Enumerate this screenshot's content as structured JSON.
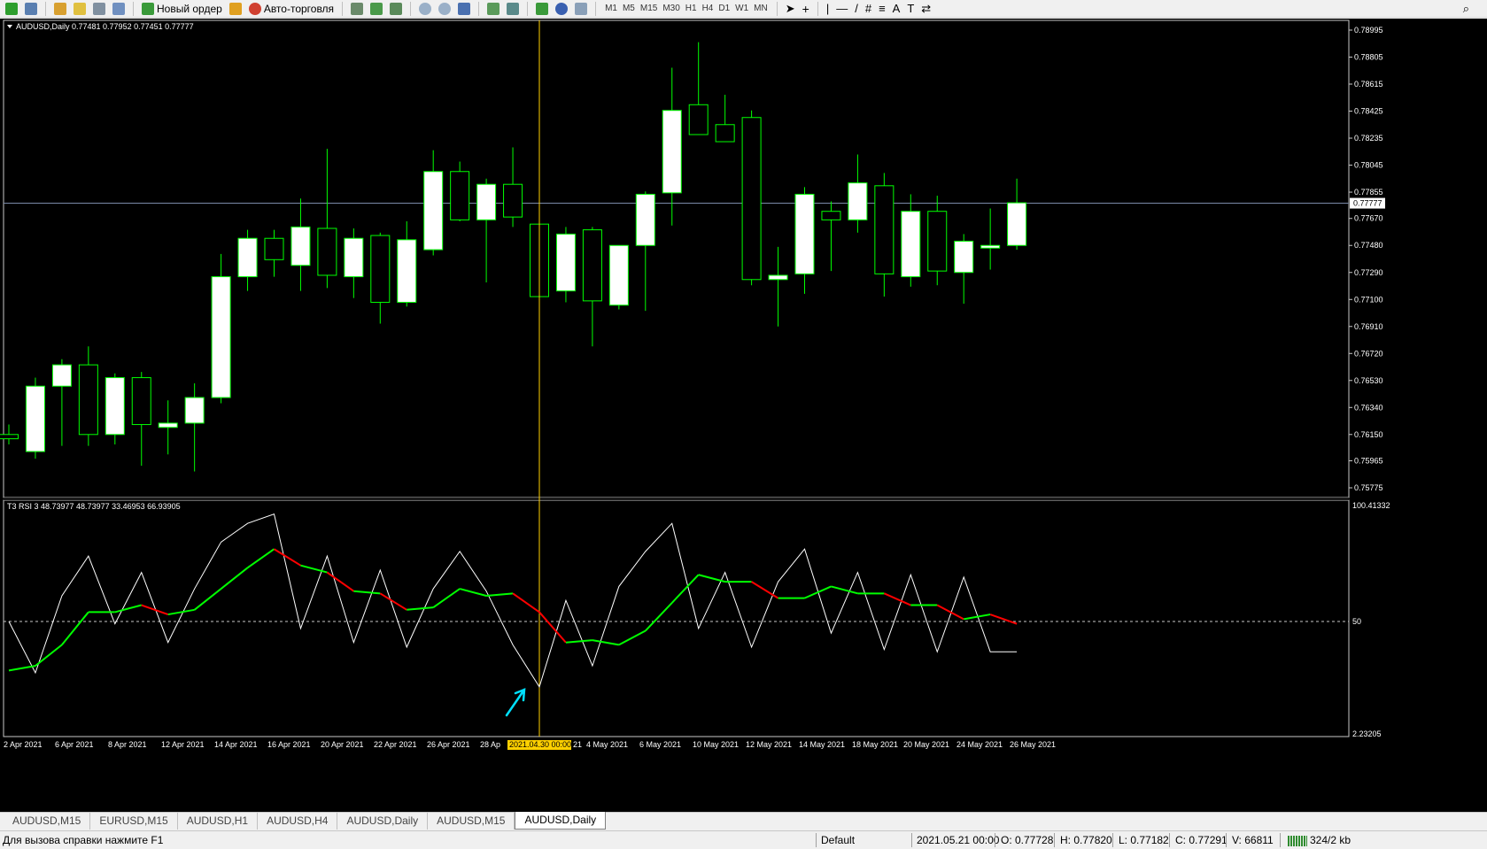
{
  "toolbar": {
    "new_order_label": "Новый ордер",
    "autotrading_label": "Авто-торговля",
    "timeframes": [
      "M1",
      "M5",
      "M15",
      "M30",
      "H1",
      "H4",
      "D1",
      "W1",
      "MN"
    ]
  },
  "main_chart": {
    "header": "AUDUSD,Daily  0.77481 0.77952 0.77451 0.77777",
    "current_price_label": "0.77777",
    "price_labels": [
      "0.78995",
      "0.78805",
      "0.78615",
      "0.78425",
      "0.78235",
      "0.78045",
      "0.77855",
      "0.77670",
      "0.77480",
      "0.77290",
      "0.77100",
      "0.76910",
      "0.76720",
      "0.76530",
      "0.76340",
      "0.76150",
      "0.75965",
      "0.75775"
    ]
  },
  "indicator": {
    "header": "T3 RSI 3 48.73977 48.73977 33.46953 66.93905",
    "top_label": "100.41332",
    "mid_label": "50",
    "bottom_label": "2.23205"
  },
  "x_axis": {
    "labels": [
      "2 Apr 2021",
      "6 Apr 2021",
      "8 Apr 2021",
      "12 Apr 2021",
      "14 Apr 2021",
      "16 Apr 2021",
      "20 Apr 2021",
      "22 Apr 2021",
      "26 Apr 2021",
      "28 Ap",
      "21",
      "4 May 2021",
      "6 May 2021",
      "10 May 2021",
      "12 May 2021",
      "14 May 2021",
      "18 May 2021",
      "20 May 2021",
      "24 May 2021",
      "26 May 2021"
    ],
    "crosshair_label": "2021.04.30 00:00"
  },
  "chart_data": {
    "type": "candlestick",
    "symbol": "AUDUSD",
    "timeframe": "Daily",
    "ylim": [
      0.75775,
      0.78995
    ],
    "candles": [
      {
        "o": 0.7615,
        "h": 0.7622,
        "l": 0.7608,
        "c": 0.7612
      },
      {
        "o": 0.7603,
        "h": 0.7655,
        "l": 0.7598,
        "c": 0.7649
      },
      {
        "o": 0.7649,
        "h": 0.7668,
        "l": 0.7607,
        "c": 0.7664
      },
      {
        "o": 0.7664,
        "h": 0.7677,
        "l": 0.7607,
        "c": 0.7615
      },
      {
        "o": 0.7615,
        "h": 0.7658,
        "l": 0.7608,
        "c": 0.7655
      },
      {
        "o": 0.7655,
        "h": 0.7659,
        "l": 0.7593,
        "c": 0.7622
      },
      {
        "o": 0.762,
        "h": 0.7639,
        "l": 0.7601,
        "c": 0.7623
      },
      {
        "o": 0.7623,
        "h": 0.7651,
        "l": 0.7589,
        "c": 0.7641
      },
      {
        "o": 0.7641,
        "h": 0.7742,
        "l": 0.7637,
        "c": 0.7726
      },
      {
        "o": 0.7726,
        "h": 0.7759,
        "l": 0.7716,
        "c": 0.7753
      },
      {
        "o": 0.7753,
        "h": 0.7759,
        "l": 0.7726,
        "c": 0.7738
      },
      {
        "o": 0.7734,
        "h": 0.7781,
        "l": 0.7716,
        "c": 0.7761
      },
      {
        "o": 0.776,
        "h": 0.7816,
        "l": 0.7718,
        "c": 0.7727
      },
      {
        "o": 0.7726,
        "h": 0.776,
        "l": 0.7711,
        "c": 0.7753
      },
      {
        "o": 0.7755,
        "h": 0.7757,
        "l": 0.7693,
        "c": 0.7708
      },
      {
        "o": 0.7708,
        "h": 0.7765,
        "l": 0.7705,
        "c": 0.7752
      },
      {
        "o": 0.7745,
        "h": 0.7815,
        "l": 0.7741,
        "c": 0.78
      },
      {
        "o": 0.78,
        "h": 0.7807,
        "l": 0.7765,
        "c": 0.7766
      },
      {
        "o": 0.7766,
        "h": 0.7795,
        "l": 0.7722,
        "c": 0.7791
      },
      {
        "o": 0.7791,
        "h": 0.7817,
        "l": 0.7761,
        "c": 0.7768
      },
      {
        "o": 0.7763,
        "h": 0.7784,
        "l": 0.7743,
        "c": 0.7712
      },
      {
        "o": 0.7716,
        "h": 0.7761,
        "l": 0.7708,
        "c": 0.7756
      },
      {
        "o": 0.7759,
        "h": 0.7761,
        "l": 0.7677,
        "c": 0.7709
      },
      {
        "o": 0.7706,
        "h": 0.7748,
        "l": 0.7703,
        "c": 0.7748
      },
      {
        "o": 0.7748,
        "h": 0.7786,
        "l": 0.7702,
        "c": 0.7784
      },
      {
        "o": 0.7785,
        "h": 0.7873,
        "l": 0.7762,
        "c": 0.7843
      },
      {
        "o": 0.7847,
        "h": 0.7891,
        "l": 0.7832,
        "c": 0.7826
      },
      {
        "o": 0.7833,
        "h": 0.7854,
        "l": 0.7821,
        "c": 0.7821
      },
      {
        "o": 0.7838,
        "h": 0.7843,
        "l": 0.772,
        "c": 0.7724
      },
      {
        "o": 0.7724,
        "h": 0.7747,
        "l": 0.7691,
        "c": 0.7727
      },
      {
        "o": 0.7728,
        "h": 0.7789,
        "l": 0.7714,
        "c": 0.7784
      },
      {
        "o": 0.7772,
        "h": 0.7779,
        "l": 0.773,
        "c": 0.7766
      },
      {
        "o": 0.7766,
        "h": 0.7812,
        "l": 0.7757,
        "c": 0.7792
      },
      {
        "o": 0.779,
        "h": 0.7799,
        "l": 0.7712,
        "c": 0.7728
      },
      {
        "o": 0.7726,
        "h": 0.7784,
        "l": 0.7719,
        "c": 0.7772
      },
      {
        "o": 0.7772,
        "h": 0.7783,
        "l": 0.772,
        "c": 0.773
      },
      {
        "o": 0.7729,
        "h": 0.7756,
        "l": 0.7707,
        "c": 0.7751
      },
      {
        "o": 0.7748,
        "h": 0.7774,
        "l": 0.7731,
        "c": 0.7748
      },
      {
        "o": 0.7748,
        "h": 0.7795,
        "l": 0.7745,
        "c": 0.7778
      }
    ],
    "rsi_fast": [
      50,
      28,
      61,
      78,
      49,
      71,
      41,
      64,
      84,
      92,
      96,
      47,
      78,
      41,
      72,
      39,
      64,
      80,
      63,
      40,
      22,
      59,
      31,
      65,
      80,
      92,
      47,
      71,
      39,
      67,
      81,
      45,
      71,
      38,
      70,
      37,
      69,
      37,
      37
    ],
    "rsi_smooth": [
      29,
      31,
      40,
      54,
      54,
      57,
      53,
      55,
      64,
      73,
      81,
      74,
      71,
      63,
      62,
      55,
      56,
      64,
      61,
      62,
      54,
      41,
      42,
      40,
      46,
      58,
      70,
      67,
      67,
      60,
      60,
      65,
      62,
      62,
      57,
      57,
      51,
      53,
      49
    ],
    "rsi_ylim": [
      2.23205,
      100.41332
    ],
    "level": 50,
    "current_price": 0.77777,
    "crosshair_index": 20
  },
  "colors": {
    "bull_body": "#ffffff",
    "candle_outline": "#00ff00",
    "rsi_fast": "#ffffff",
    "rsi_up": "#00ff00",
    "rsi_down": "#ff0000",
    "crosshair": "#ffd000",
    "arrow": "#00e0ff"
  },
  "tabs": [
    "AUDUSD,M15",
    "EURUSD,M15",
    "AUDUSD,H1",
    "AUDUSD,H4",
    "AUDUSD,Daily",
    "AUDUSD,M15",
    "AUDUSD,Daily"
  ],
  "status": {
    "help": "Для вызова справки нажмите F1",
    "profile": "Default",
    "datetime": "2021.05.21 00:00",
    "open": "O: 0.77728",
    "high": "H: 0.77820",
    "low": "L: 0.77182",
    "close": "C: 0.77291",
    "volume": "V: 66811",
    "traffic": "324/2 kb"
  }
}
